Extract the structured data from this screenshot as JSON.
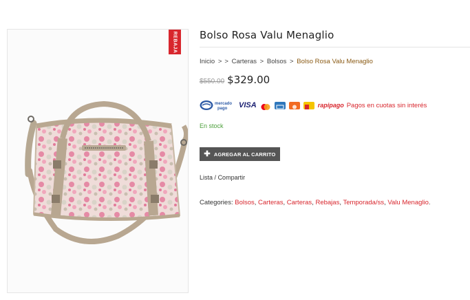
{
  "product": {
    "sale_badge": "REBAJA",
    "title": "Bolso Rosa Valu Menaglio",
    "old_price": "$550.00",
    "price": "$329.00",
    "stock": "En stock",
    "add_to_cart": "AGREGAR AL CARRITO"
  },
  "breadcrumb": {
    "home": "Inicio",
    "sep1": ">",
    "sep2": ">",
    "carteras": "Carteras",
    "sep3": ">",
    "bolsos": "Bolsos",
    "sep4": ">",
    "current": "Bolso Rosa Valu Menaglio"
  },
  "payment": {
    "mp_line1": "mercado",
    "mp_line2": "pago",
    "visa": "VISA",
    "rapipago": "rapipago",
    "installments": "Pagos en cuotas sin interés"
  },
  "share": {
    "list": "Lista",
    "sep": "/",
    "share": "Compartir"
  },
  "categories": {
    "label": "Categories:",
    "items": [
      "Bolsos",
      "Carteras",
      "Carteras",
      "Rebajas",
      "Temporada/ss",
      "Valu Menaglio"
    ]
  },
  "colors": {
    "accent": "#d8262d",
    "stock": "#4b9f3a",
    "button": "#555555",
    "bag_pink": "#e8a3b5",
    "bag_strap": "#b8a791"
  }
}
